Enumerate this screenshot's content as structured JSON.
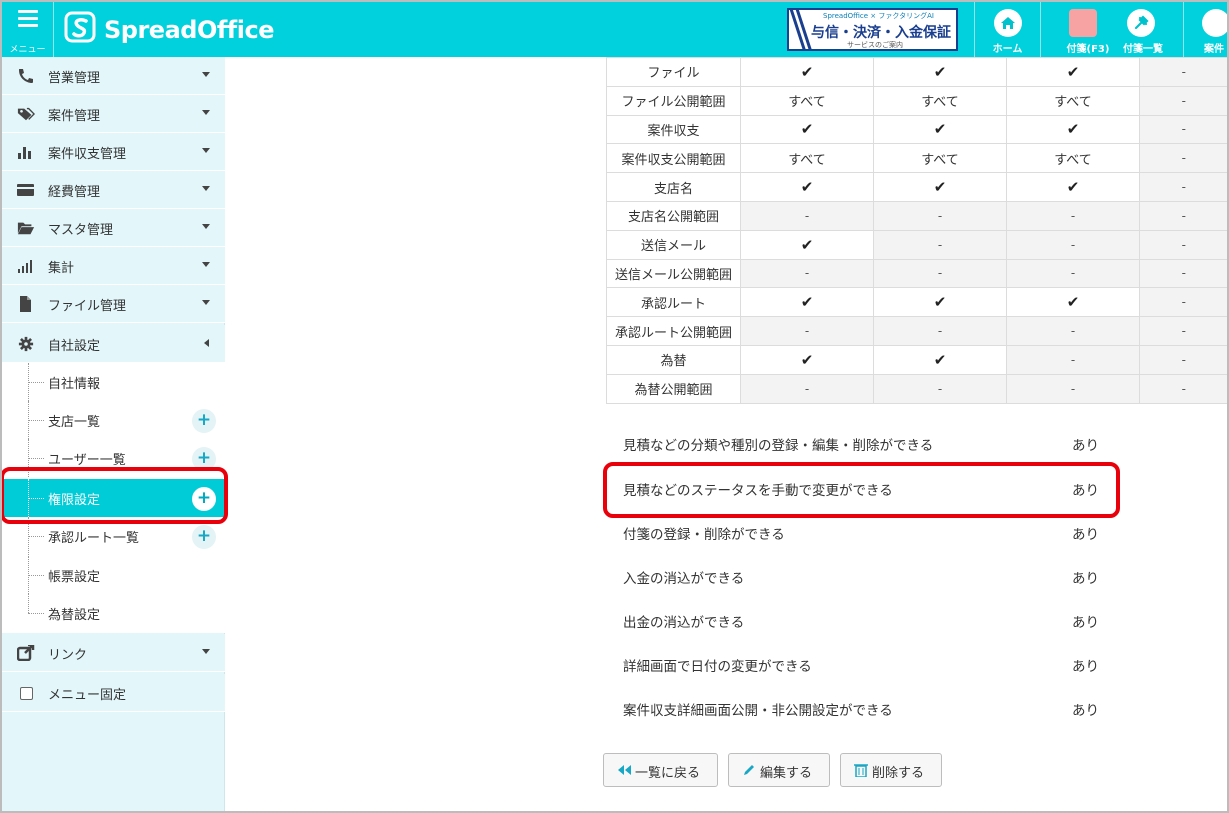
{
  "header": {
    "menu_label": "メニュー",
    "logo_text": "SpreadOffice",
    "banner": {
      "top_text": "SpreadOffice × ファクタリングAI",
      "main_text": "与信・決済・入金保証",
      "sub_text": "サービスのご案内"
    },
    "buttons": [
      {
        "label": "ホーム"
      },
      {
        "label": "付箋(F3)"
      },
      {
        "label": "付箋一覧"
      },
      {
        "label": "案件"
      }
    ],
    "colors": {
      "primary": "#00d1dc",
      "highlight": "#e8000b"
    }
  },
  "sidebar": {
    "items": [
      {
        "label": "営業管理",
        "icon": "phone-icon"
      },
      {
        "label": "案件管理",
        "icon": "tags-icon"
      },
      {
        "label": "案件収支管理",
        "icon": "bar-chart-icon"
      },
      {
        "label": "経費管理",
        "icon": "credit-card-icon"
      },
      {
        "label": "マスタ管理",
        "icon": "folder-open-icon"
      },
      {
        "label": "集計",
        "icon": "signal-icon"
      },
      {
        "label": "ファイル管理",
        "icon": "file-icon"
      },
      {
        "label": "自社設定",
        "icon": "gear-icon"
      }
    ],
    "sub_items": [
      {
        "label": "自社情報",
        "has_plus": false
      },
      {
        "label": "支店一覧",
        "has_plus": true
      },
      {
        "label": "ユーザー一覧",
        "has_plus": true
      },
      {
        "label": "権限設定",
        "has_plus": true,
        "active": true
      },
      {
        "label": "承認ルート一覧",
        "has_plus": true
      },
      {
        "label": "帳票設定",
        "has_plus": false
      },
      {
        "label": "為替設定",
        "has_plus": false
      }
    ],
    "bottom_items": [
      {
        "label": "リンク",
        "icon": "external-link-icon"
      },
      {
        "label": "メニュー固定",
        "icon": "checkbox-icon"
      }
    ],
    "plus_symbol": "+"
  },
  "table": {
    "rows": [
      {
        "label": "ファイル",
        "cells": [
          "✔",
          "✔",
          "✔",
          "-"
        ]
      },
      {
        "label": "ファイル公開範囲",
        "cells": [
          "すべて",
          "すべて",
          "すべて",
          "-"
        ]
      },
      {
        "label": "案件収支",
        "cells": [
          "✔",
          "✔",
          "✔",
          "-"
        ]
      },
      {
        "label": "案件収支公開範囲",
        "cells": [
          "すべて",
          "すべて",
          "すべて",
          "-"
        ]
      },
      {
        "label": "支店名",
        "cells": [
          "✔",
          "✔",
          "✔",
          "-"
        ]
      },
      {
        "label": "支店名公開範囲",
        "cells": [
          "-",
          "-",
          "-",
          "-"
        ]
      },
      {
        "label": "送信メール",
        "cells": [
          "✔",
          "-",
          "-",
          "-"
        ]
      },
      {
        "label": "送信メール公開範囲",
        "cells": [
          "-",
          "-",
          "-",
          "-"
        ]
      },
      {
        "label": "承認ルート",
        "cells": [
          "✔",
          "✔",
          "✔",
          "-"
        ]
      },
      {
        "label": "承認ルート公開範囲",
        "cells": [
          "-",
          "-",
          "-",
          "-"
        ]
      },
      {
        "label": "為替",
        "cells": [
          "✔",
          "✔",
          "-",
          "-"
        ]
      },
      {
        "label": "為替公開範囲",
        "cells": [
          "-",
          "-",
          "-",
          "-"
        ]
      }
    ]
  },
  "permissions": [
    {
      "label": "見積などの分類や種別の登録・編集・削除ができる",
      "value": "あり"
    },
    {
      "label": "見積などのステータスを手動で変更ができる",
      "value": "あり"
    },
    {
      "label": "付箋の登録・削除ができる",
      "value": "あり"
    },
    {
      "label": "入金の消込ができる",
      "value": "あり"
    },
    {
      "label": "出金の消込ができる",
      "value": "あり"
    },
    {
      "label": "詳細画面で日付の変更ができる",
      "value": "あり"
    },
    {
      "label": "案件収支詳細画面公開・非公開設定ができる",
      "value": "あり"
    }
  ],
  "actions": {
    "back": "一覧に戻る",
    "edit": "編集する",
    "delete": "削除する"
  }
}
